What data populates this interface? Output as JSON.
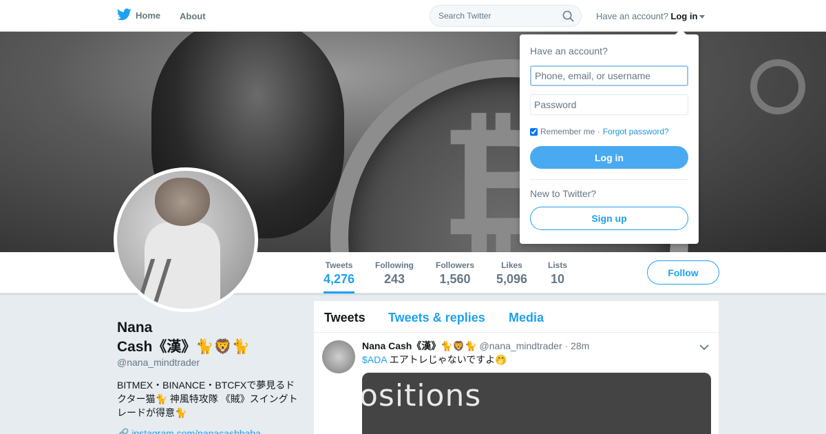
{
  "nav": {
    "home_label": "Home",
    "about_label": "About",
    "search_placeholder": "Search Twitter",
    "have_account": "Have an account?",
    "login_label": "Log in"
  },
  "profile": {
    "name_line1": "Nana",
    "name_line2": "Cash《漢》🐈🦁🐈",
    "handle": "@nana_mindtrader",
    "bio": "BITMEX・BINANCE・BTCFXで夢見るドクター猫🐈 神風特攻隊 《賊》スイングトレードが得意🐈",
    "link": "🔗 instagram.com/nanacashbaba"
  },
  "stats": [
    {
      "label": "Tweets",
      "value": "4,276"
    },
    {
      "label": "Following",
      "value": "243"
    },
    {
      "label": "Followers",
      "value": "1,560"
    },
    {
      "label": "Likes",
      "value": "5,096"
    },
    {
      "label": "Lists",
      "value": "10"
    }
  ],
  "follow_label": "Follow",
  "timeline": {
    "tabs": [
      "Tweets",
      "Tweets & replies",
      "Media"
    ],
    "tweet": {
      "author": "Nana Cash《漢》🐈🦁🐈",
      "meta": "@nana_mindtrader · 28m",
      "cashtag": "$ADA",
      "text": " エアトレじゃないですよ🤭",
      "media_text": "ositions"
    }
  },
  "login_dropdown": {
    "title": "Have an account?",
    "username_placeholder": "Phone, email, or username",
    "password_placeholder": "Password",
    "remember": "Remember me ·",
    "forgot": "Forgot password?",
    "login_button": "Log in",
    "new_to": "New to Twitter?",
    "signup_button": "Sign up"
  },
  "colors": {
    "brand_blue": "#1da1f2",
    "background": "#e6ecf0"
  }
}
